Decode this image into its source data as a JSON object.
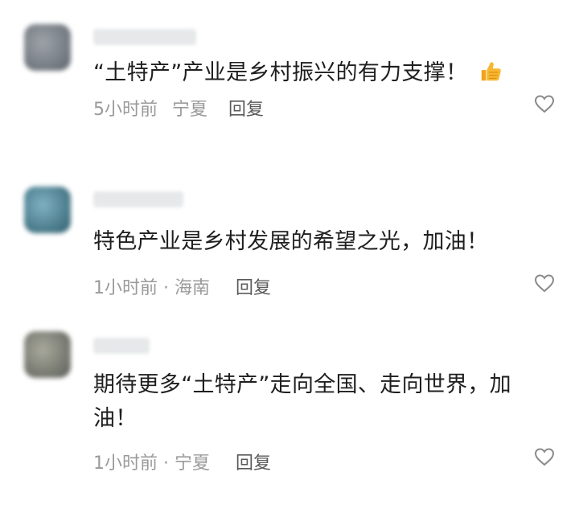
{
  "comments": [
    {
      "text": "“土特产”产业是乡村振兴的有力支撑！",
      "time": "5小时前",
      "location": "宁夏",
      "reply_label": "回复",
      "emoji": "thumbs-up-icon",
      "avatar_colors": [
        "#8a8f96",
        "#5f666e"
      ]
    },
    {
      "text": "特色产业是乡村发展的希望之光，加油！",
      "time": "1小时前 · 海南",
      "reply_label": "回复",
      "avatar_colors": [
        "#6f9fb0",
        "#2f5f6e"
      ]
    },
    {
      "text": "期待更多“土特产”走向全国、走向世界，加油！",
      "time": "1小时前 · 宁夏",
      "reply_label": "回复",
      "avatar_colors": [
        "#9a9a8c",
        "#5a5e58"
      ]
    }
  ],
  "icons": {
    "like": "heart-outline-icon"
  },
  "colors": {
    "meta": "#9a9a9a",
    "reply": "#5a5a5a",
    "text": "#1f1f1f"
  }
}
